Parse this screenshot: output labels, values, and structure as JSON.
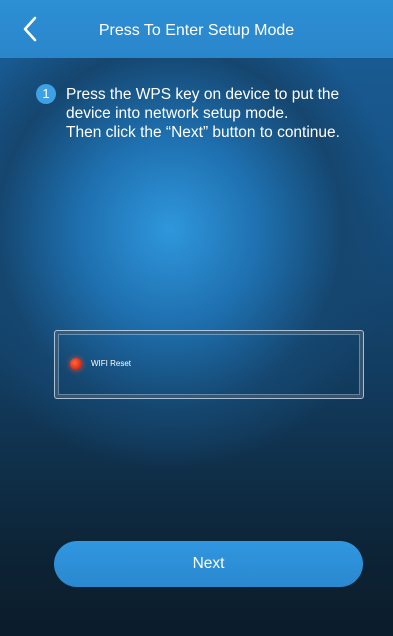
{
  "header": {
    "title": "Press To Enter Setup Mode",
    "back_icon": "chevron-left-icon"
  },
  "step": {
    "number": "1",
    "lines": [
      "Press the WPS key on device to put the",
      "device into network setup mode.",
      "Then click the “Next” button to continue."
    ]
  },
  "device": {
    "led_label": "WIFI Reset",
    "led_color": "#d9301a"
  },
  "actions": {
    "next_label": "Next"
  },
  "colors": {
    "header": "#2d8fd5",
    "accent": "#3ea1e6",
    "button": "#2c8ed8"
  }
}
